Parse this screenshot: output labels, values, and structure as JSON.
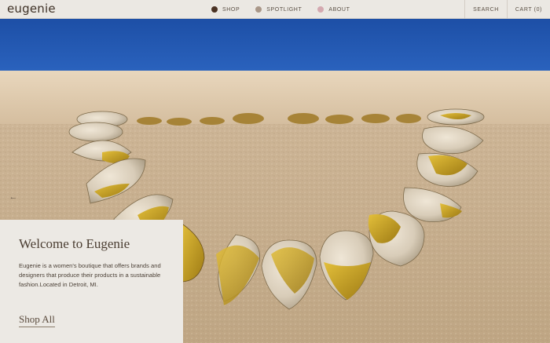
{
  "header": {
    "logo": "eugenie",
    "nav": [
      {
        "label": "SHOP",
        "color": "#4a3224"
      },
      {
        "label": "SPOTLIGHT",
        "color": "#a99788"
      },
      {
        "label": "ABOUT",
        "color": "#d4a9b0"
      }
    ],
    "search_label": "SEARCH",
    "cart_label": "CART (0)"
  },
  "hero": {
    "image_description_icon": "necklace-photo",
    "prev_icon": "arrow-left-icon",
    "next_icon": "arrow-right-icon"
  },
  "welcome": {
    "title": "Welcome to Eugenie",
    "body": "Eugenie is a women's boutique that offers brands and designers that produce their products in a sustainable fashion.Located in Detroit, MI.",
    "link": "Shop All"
  }
}
